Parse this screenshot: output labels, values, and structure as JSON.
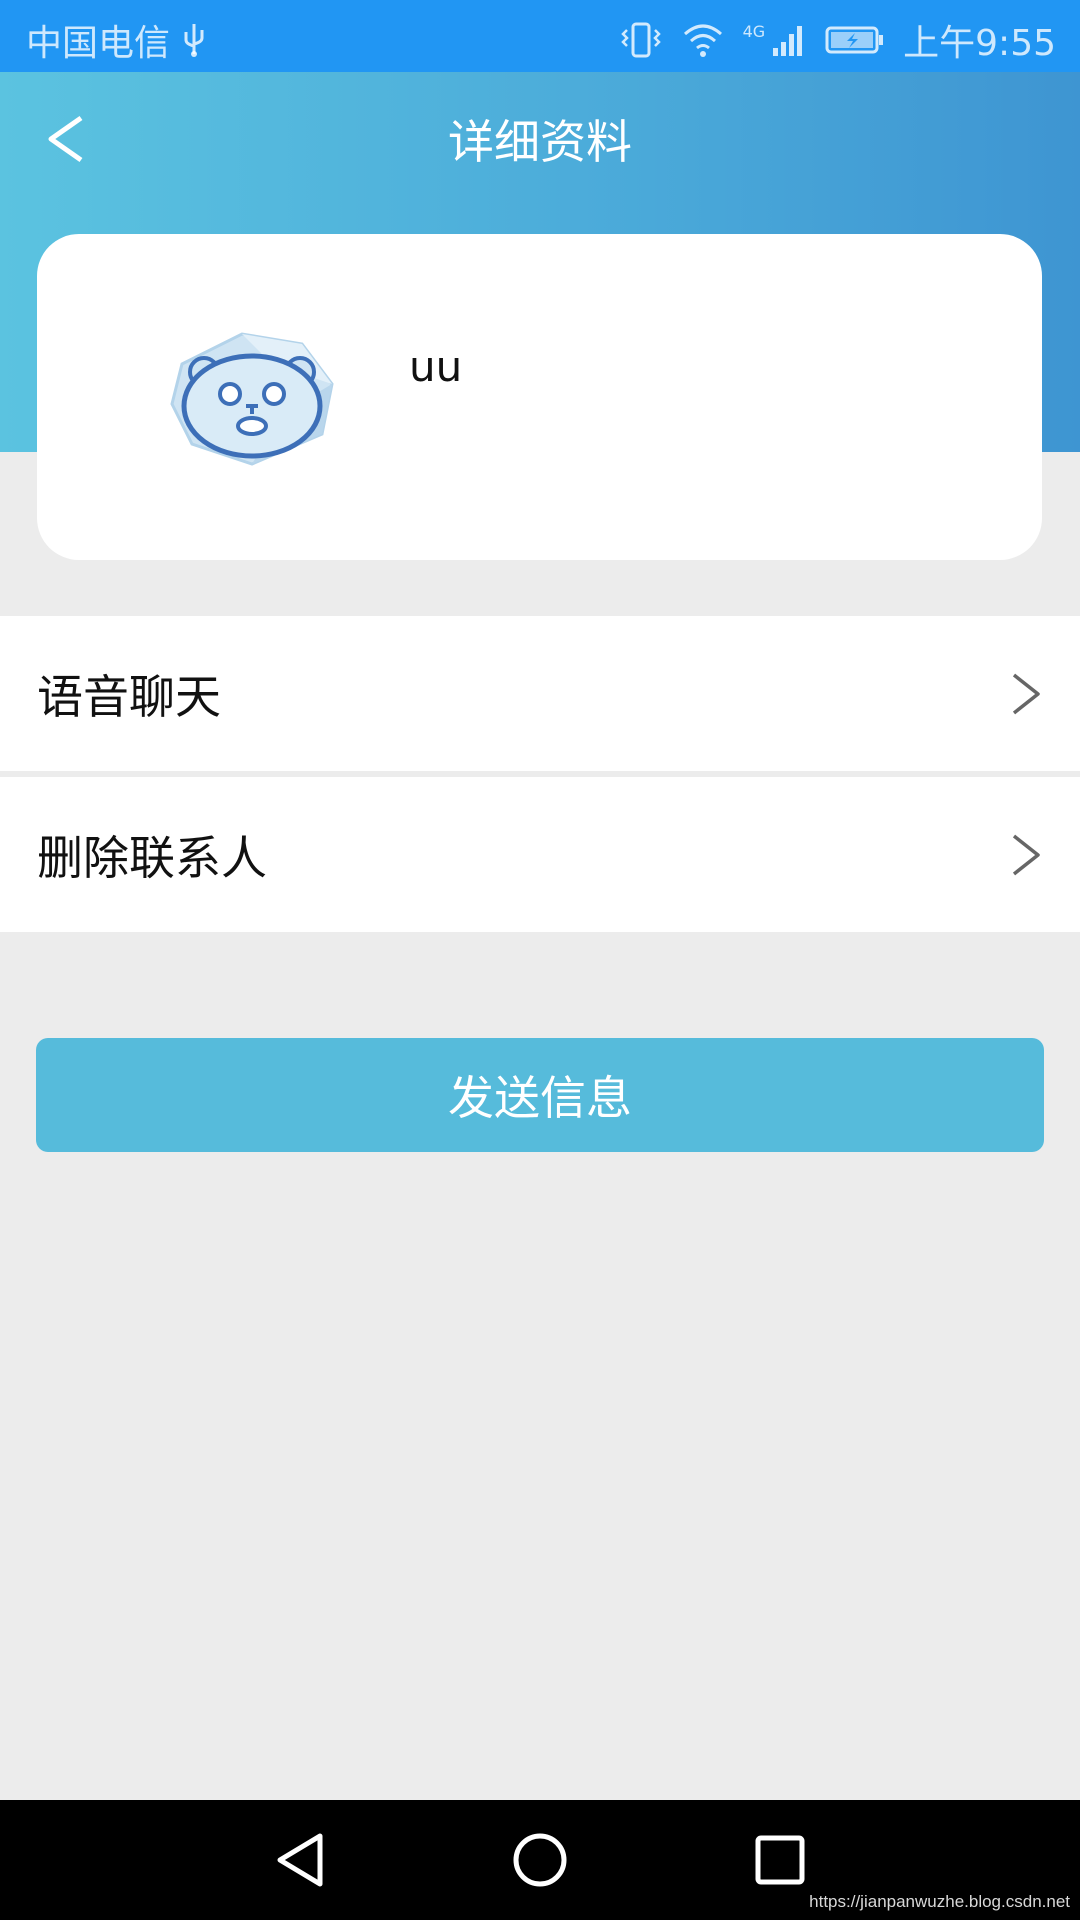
{
  "status_bar": {
    "carrier": "中国电信",
    "time": "上午9:55",
    "network": "4G",
    "icons": [
      "usb-icon",
      "vibrate-icon",
      "wifi-icon",
      "signal-icon",
      "battery-icon"
    ]
  },
  "header": {
    "title": "详细资料",
    "back_icon": "chevron-left-icon",
    "gradient_colors": [
      "#5bc3e0",
      "#3e95d2"
    ]
  },
  "profile": {
    "name": "uu",
    "avatar_icon": "bear-avatar-icon"
  },
  "menu": {
    "items": [
      {
        "label": "语音聊天",
        "icon": "chevron-right-icon"
      },
      {
        "label": "删除联系人",
        "icon": "chevron-right-icon"
      }
    ]
  },
  "actions": {
    "send_label": "发送信息",
    "send_color": "#56bbdb"
  },
  "nav_bar": {
    "icons": [
      "nav-back-icon",
      "nav-home-icon",
      "nav-recents-icon"
    ]
  },
  "watermark": "https://jianpanwuzhe.blog.csdn.net",
  "colors": {
    "status_bar": "#2196f3",
    "background": "#ececec"
  }
}
